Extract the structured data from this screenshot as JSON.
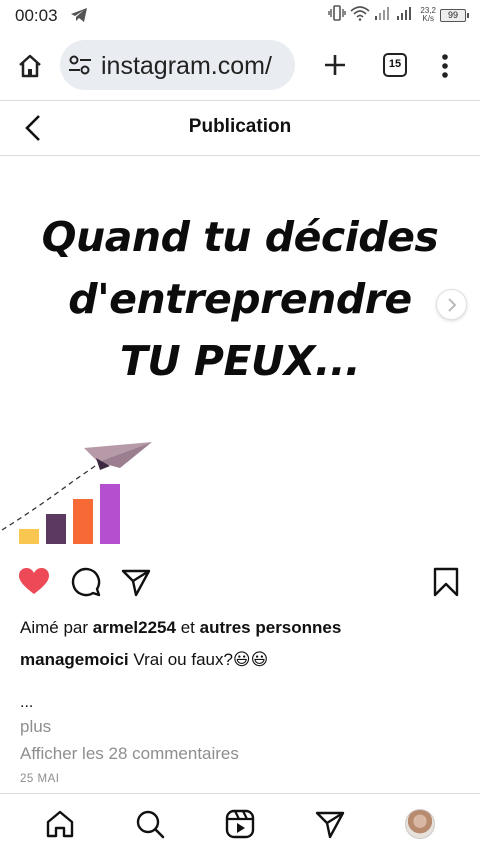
{
  "status_bar": {
    "time": "00:03",
    "net_speed_value": "23,2",
    "net_speed_unit": "K/s",
    "battery": "99"
  },
  "browser": {
    "url": "instagram.com/",
    "tab_count": "15"
  },
  "header": {
    "title": "Publication"
  },
  "post_image": {
    "headline_line1": "Quand tu décides",
    "headline_line2": "d'entreprendre",
    "headline_line3": "TU PEUX...",
    "chart_bars": [
      {
        "value": 1,
        "color": "#f9c74f"
      },
      {
        "value": 2,
        "color": "#5b3a60"
      },
      {
        "value": 3,
        "color": "#f86a35"
      },
      {
        "value": 4,
        "color": "#b44fd0"
      }
    ]
  },
  "likes": {
    "prefix": "Aimé par",
    "user": "armel2254",
    "connector": "et",
    "others": "autres personnes"
  },
  "caption": {
    "username": "managemoici",
    "text": "Vrai ou faux?😃😃"
  },
  "ellipsis": "...",
  "more_label": "plus",
  "comments_link": "Afficher les 28 commentaires",
  "date": "25 MAI",
  "colors": {
    "like_red": "#ed4956",
    "muted_gray": "#8e8e8e",
    "url_pill": "#e9ecf1"
  },
  "icons": [
    "telegram-icon",
    "vibrate-icon",
    "wifi-icon",
    "signal-icon",
    "battery-icon",
    "home-icon",
    "tune-icon",
    "plus-icon",
    "tabs-icon",
    "more-vert-icon",
    "back-icon",
    "chevron-right-icon",
    "heart-icon",
    "comment-icon",
    "share-icon",
    "bookmark-icon",
    "search-icon",
    "reels-icon",
    "direct-icon"
  ]
}
